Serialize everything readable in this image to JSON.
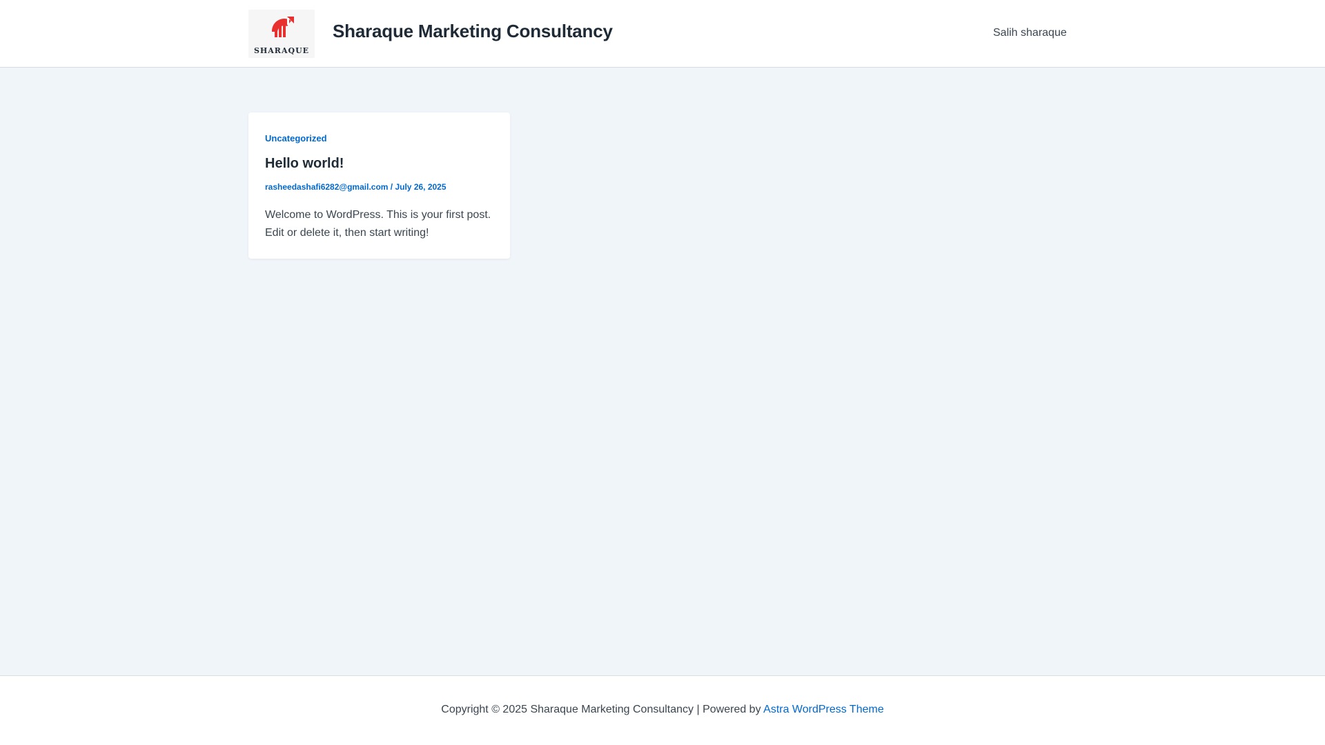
{
  "header": {
    "logo_text": "SHARAQUE",
    "site_title": "Sharaque Marketing Consultancy",
    "nav": [
      {
        "label": "Salih sharaque"
      }
    ]
  },
  "post": {
    "category": "Uncategorized",
    "title": "Hello world!",
    "author": "rasheedashafi6282@gmail.com",
    "separator": " / ",
    "date": "July 26, 2025",
    "excerpt": "Welcome to WordPress. This is your first post. Edit or delete it, then start writing!"
  },
  "footer": {
    "copyright": "Copyright © 2025 Sharaque Marketing Consultancy | Powered by ",
    "theme_link": "Astra WordPress Theme"
  },
  "colors": {
    "accent": "#0069d0",
    "logo_red": "#e8312f",
    "background": "#f0f5fa",
    "heading": "#1e2a35"
  },
  "icons": {
    "logo": "sharaque-chart-logo-icon"
  }
}
